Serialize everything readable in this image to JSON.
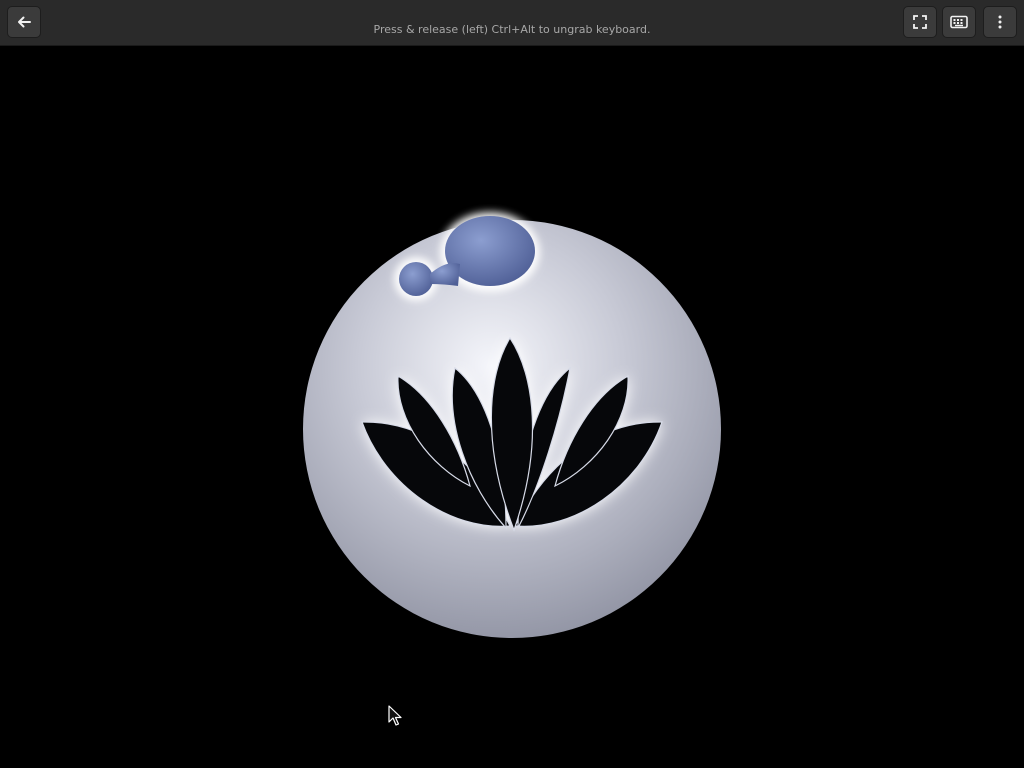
{
  "header": {
    "hint_text": "Press & release (left) Ctrl+Alt to ungrab keyboard.",
    "buttons": {
      "back_icon": "arrow-left-icon",
      "fullscreen_icon": "fullscreen-icon",
      "keyboard_icon": "keyboard-icon",
      "menu_icon": "vertical-dots-icon"
    }
  },
  "screen": {
    "background_color": "#000000",
    "logo_icon": "lotus-orb-logo",
    "cursor_icon": "mouse-pointer-icon"
  }
}
